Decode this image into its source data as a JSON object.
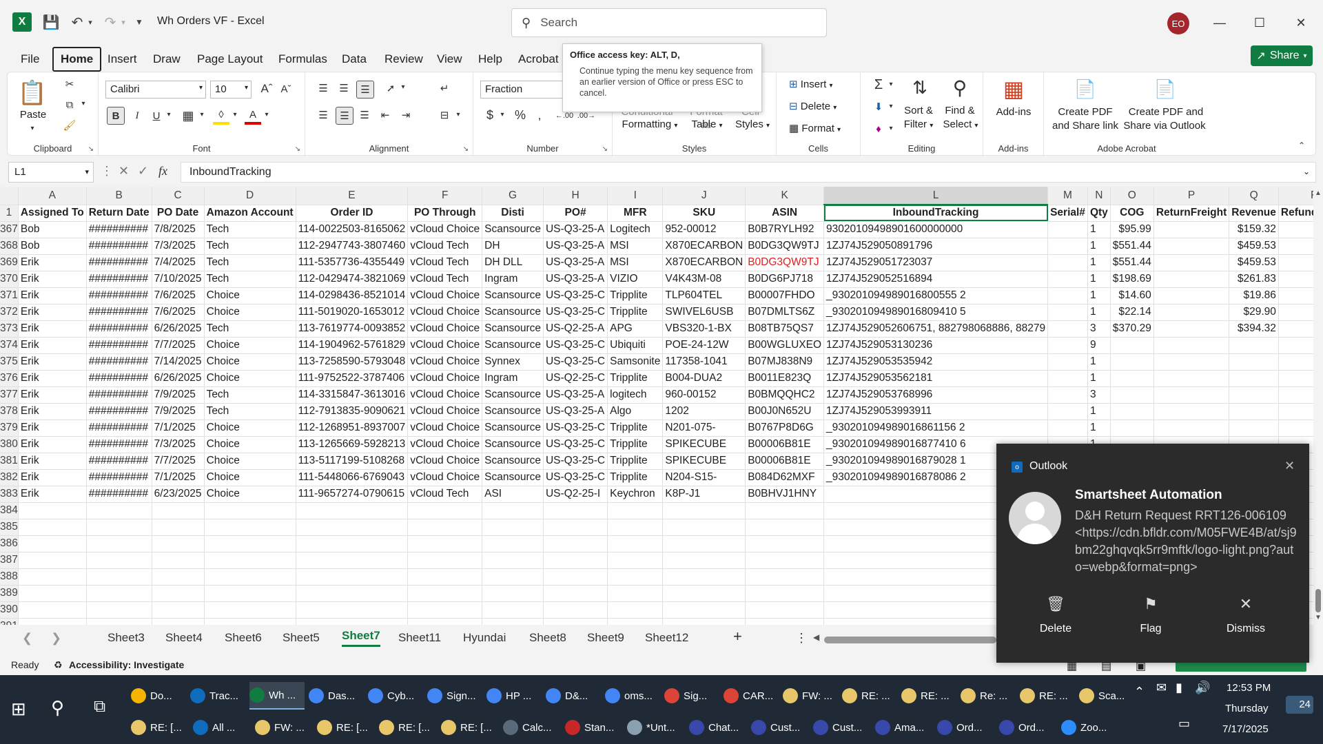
{
  "window": {
    "title": "Wh Orders VF  -  Excel",
    "search_placeholder": "Search",
    "user_initials": "EO",
    "share_label": "Share"
  },
  "menu_tabs": [
    "File",
    "Home",
    "Insert",
    "Draw",
    "Page Layout",
    "Formulas",
    "Data",
    "Review",
    "View",
    "Help",
    "Acrobat"
  ],
  "ribbon": {
    "clipboard": {
      "label": "Clipboard",
      "paste": "Paste"
    },
    "font": {
      "label": "Font",
      "name": "Calibri",
      "size": "10"
    },
    "alignment": {
      "label": "Alignment"
    },
    "number": {
      "label": "Number",
      "format": "Fraction"
    },
    "styles": {
      "label": "Styles",
      "conditional": "Conditional",
      "formatting": "Formatting",
      "format_as": "Format as",
      "table": "Table",
      "cell": "Cell",
      "cell_styles": "Styles"
    },
    "cells": {
      "label": "Cells",
      "insert": "Insert",
      "delete": "Delete",
      "format": "Format"
    },
    "editing": {
      "label": "Editing",
      "sort": "Sort &",
      "filter": "Filter",
      "find": "Find &",
      "select": "Select"
    },
    "addins": {
      "label": "Add-ins",
      "addins": "Add-ins"
    },
    "acrobat": {
      "label": "Adobe Acrobat",
      "pdf1a": "Create PDF",
      "pdf1b": "and Share link",
      "pdf2a": "Create PDF and",
      "pdf2b": "Share via Outlook"
    }
  },
  "tooltip": {
    "title": "Office access key: ALT, D,",
    "body": "Continue typing the menu key sequence from an earlier version of Office or press ESC to cancel."
  },
  "formula_bar": {
    "name_box": "L1",
    "fx": "fx",
    "content": "InboundTracking"
  },
  "grid": {
    "columns": [
      "A",
      "B",
      "C",
      "D",
      "E",
      "F",
      "G",
      "H",
      "I",
      "J",
      "K",
      "L",
      "M",
      "N",
      "O",
      "P",
      "Q",
      "R"
    ],
    "header_row": {
      "row_num": "1",
      "cells": [
        "Assigned To",
        "Return Date",
        "PO Date",
        "Amazon Account",
        "Order ID",
        "PO Through",
        "Disti",
        "PO#",
        "MFR",
        "SKU",
        "ASIN",
        "InboundTracking",
        "Serial#",
        "Qty",
        "COG",
        "ReturnFreight",
        "Revenue",
        "Refund Issue"
      ]
    },
    "rows": [
      {
        "n": "367",
        "c": [
          "Bob",
          "##########",
          "7/8/2025",
          "Tech",
          "114-0022503-8165062",
          "vCloud Choice",
          "Scansource",
          "US-Q3-25-A",
          "Logitech",
          "952-00012",
          "B0B7RYLH92",
          "93020109498901600000000",
          "",
          "1",
          "$95.99",
          "",
          "$159.32",
          ""
        ]
      },
      {
        "n": "368",
        "c": [
          "Bob",
          "##########",
          "7/3/2025",
          "Tech",
          "112-2947743-3807460",
          "vCloud Tech",
          "DH",
          "US-Q3-25-A",
          "MSI",
          "X870ECARBON",
          "B0DG3QW9TJ",
          "1ZJ74J529050891796",
          "",
          "1",
          "$551.44",
          "",
          "$459.53",
          ""
        ]
      },
      {
        "n": "369",
        "c": [
          "Erik",
          "##########",
          "7/4/2025",
          "Tech",
          "111-5357736-4355449",
          "vCloud Tech",
          "DH DLL",
          "US-Q3-25-A",
          "MSI",
          "X870ECARBON",
          "B0DG3QW9TJ",
          "1ZJ74J529051723037",
          "",
          "1",
          "$551.44",
          "",
          "$459.53",
          ""
        ]
      },
      {
        "n": "370",
        "c": [
          "Erik",
          "##########",
          "7/10/2025",
          "Tech",
          "112-0429474-3821069",
          "vCloud Tech",
          "Ingram",
          "US-Q3-25-A",
          "VIZIO",
          "V4K43M-08",
          "B0DG6PJ718",
          "1ZJ74J529052516894",
          "",
          "1",
          "$198.69",
          "",
          "$261.83",
          ""
        ]
      },
      {
        "n": "371",
        "c": [
          "Erik",
          "##########",
          "7/6/2025",
          "Choice",
          "114-0298436-8521014",
          "vCloud Choice",
          "Scansource",
          "US-Q3-25-C",
          "Tripplite",
          "TLP604TEL",
          "B00007FHDO",
          "_930201094989016800555 2",
          "",
          "1",
          "$14.60",
          "",
          "$19.86",
          ""
        ]
      },
      {
        "n": "372",
        "c": [
          "Erik",
          "##########",
          "7/6/2025",
          "Choice",
          "111-5019020-1653012",
          "vCloud Choice",
          "Scansource",
          "US-Q3-25-C",
          "Tripplite",
          "SWIVEL6USB",
          "B07DMLTS6Z",
          "_930201094989016809410 5",
          "",
          "1",
          "$22.14",
          "",
          "$29.90",
          ""
        ]
      },
      {
        "n": "373",
        "c": [
          "Erik",
          "##########",
          "6/26/2025",
          "Tech",
          "113-7619774-0093852",
          "vCloud Choice",
          "Scansource",
          "US-Q2-25-A",
          "APG",
          "VBS320-1-BX",
          "B08TB75QS7",
          "1ZJ74J529052606751, 882798068886, 88279",
          "",
          "3",
          "$370.29",
          "",
          "$394.32",
          ""
        ]
      },
      {
        "n": "374",
        "c": [
          "Erik",
          "##########",
          "7/7/2025",
          "Choice",
          "114-1904962-5761829",
          "vCloud Choice",
          "Scansource",
          "US-Q3-25-C",
          "Ubiquiti",
          "POE-24-12W",
          "B00WGLUXEO",
          "1ZJ74J529053130236",
          "",
          "9",
          "",
          "",
          "",
          ""
        ]
      },
      {
        "n": "375",
        "c": [
          "Erik",
          "##########",
          "7/14/2025",
          "Choice",
          "113-7258590-5793048",
          "vCloud Choice",
          "Synnex",
          "US-Q3-25-C",
          "Samsonite",
          "117358-1041",
          "B07MJ838N9",
          "1ZJ74J529053535942",
          "",
          "1",
          "",
          "",
          "",
          ""
        ]
      },
      {
        "n": "376",
        "c": [
          "Erik",
          "##########",
          "6/26/2025",
          "Choice",
          "111-9752522-3787406",
          "vCloud Choice",
          "Ingram",
          "US-Q2-25-C",
          "Tripplite",
          "B004-DUA2",
          "B0011E823Q",
          "1ZJ74J529053562181",
          "",
          "1",
          "",
          "",
          "",
          ""
        ]
      },
      {
        "n": "377",
        "c": [
          "Erik",
          "##########",
          "7/9/2025",
          "Tech",
          "114-3315847-3613016",
          "vCloud Choice",
          "Scansource",
          "US-Q3-25-A",
          "logitech",
          "960-00152",
          "B0BMQQHC2",
          "1ZJ74J529053768996",
          "",
          "3",
          "",
          "",
          "",
          ""
        ]
      },
      {
        "n": "378",
        "c": [
          "Erik",
          "##########",
          "7/9/2025",
          "Tech",
          "112-7913835-9090621",
          "vCloud Choice",
          "Scansource",
          "US-Q3-25-A",
          "Algo",
          "1202",
          "B00J0N652U",
          "1ZJ74J529053993911",
          "",
          "1",
          "",
          "",
          "",
          ""
        ]
      },
      {
        "n": "379",
        "c": [
          "Erik",
          "##########",
          "7/1/2025",
          "Choice",
          "112-1268951-8937007",
          "vCloud Choice",
          "Scansource",
          "US-Q3-25-C",
          "Tripplite",
          "N201-075-",
          "B0767P8D6G",
          "_930201094989016861156 2",
          "",
          "1",
          "",
          "",
          "",
          ""
        ]
      },
      {
        "n": "380",
        "c": [
          "Erik",
          "##########",
          "7/3/2025",
          "Choice",
          "113-1265669-5928213",
          "vCloud Choice",
          "Scansource",
          "US-Q3-25-C",
          "Tripplite",
          "SPIKECUBE",
          "B00006B81E",
          "_930201094989016877410 6",
          "",
          "1",
          "",
          "",
          "",
          ""
        ]
      },
      {
        "n": "381",
        "c": [
          "Erik",
          "##########",
          "7/7/2025",
          "Choice",
          "113-5117199-5108268",
          "vCloud Choice",
          "Scansource",
          "US-Q3-25-C",
          "Tripplite",
          "SPIKECUBE",
          "B00006B81E",
          "_930201094989016879028 1",
          "",
          "1",
          "",
          "",
          "",
          ""
        ]
      },
      {
        "n": "382",
        "c": [
          "Erik",
          "##########",
          "7/1/2025",
          "Choice",
          "111-5448066-6769043",
          "vCloud Choice",
          "Scansource",
          "US-Q3-25-C",
          "Tripplite",
          "N204-S15-",
          "B084D62MXF",
          "_930201094989016878086 2",
          "",
          "1",
          "",
          "",
          "",
          ""
        ]
      },
      {
        "n": "383",
        "c": [
          "Erik",
          "##########",
          "6/23/2025",
          "Choice",
          "111-9657274-0790615",
          "vCloud Tech",
          "ASI",
          "US-Q2-25-I",
          "Keychron",
          "K8P-J1",
          "B0BHVJ1HNY",
          "",
          "",
          "1",
          "",
          "",
          "",
          ""
        ]
      },
      {
        "n": "384",
        "c": [
          "",
          "",
          "",
          "",
          "",
          "",
          "",
          "",
          "",
          "",
          "",
          "",
          "",
          "",
          "",
          "",
          "",
          ""
        ]
      },
      {
        "n": "385",
        "c": [
          "",
          "",
          "",
          "",
          "",
          "",
          "",
          "",
          "",
          "",
          "",
          "",
          "",
          "",
          "",
          "",
          "",
          ""
        ]
      },
      {
        "n": "386",
        "c": [
          "",
          "",
          "",
          "",
          "",
          "",
          "",
          "",
          "",
          "",
          "",
          "",
          "",
          "",
          "",
          "",
          "",
          ""
        ]
      },
      {
        "n": "387",
        "c": [
          "",
          "",
          "",
          "",
          "",
          "",
          "",
          "",
          "",
          "",
          "",
          "",
          "",
          "",
          "",
          "",
          "",
          ""
        ]
      },
      {
        "n": "388",
        "c": [
          "",
          "",
          "",
          "",
          "",
          "",
          "",
          "",
          "",
          "",
          "",
          "",
          "",
          "",
          "",
          "",
          "",
          ""
        ]
      },
      {
        "n": "389",
        "c": [
          "",
          "",
          "",
          "",
          "",
          "",
          "",
          "",
          "",
          "",
          "",
          "",
          "",
          "",
          "",
          "",
          "",
          ""
        ]
      },
      {
        "n": "390",
        "c": [
          "",
          "",
          "",
          "",
          "",
          "",
          "",
          "",
          "",
          "",
          "",
          "",
          "",
          "",
          "",
          "",
          "",
          ""
        ]
      },
      {
        "n": "391",
        "c": [
          "",
          "",
          "",
          "",
          "",
          "",
          "",
          "",
          "",
          "",
          "",
          "",
          "",
          "",
          "",
          "",
          "",
          ""
        ]
      }
    ]
  },
  "sheets": [
    "Sheet3",
    "Sheet4",
    "Sheet6",
    "Sheet5",
    "Sheet7",
    "Sheet11",
    "Hyundai",
    "Sheet8",
    "Sheet9",
    "Sheet12"
  ],
  "active_sheet": "Sheet7",
  "status": {
    "ready": "Ready",
    "accessibility": "Accessibility: Investigate"
  },
  "notification": {
    "app": "Outlook",
    "sender": "Smartsheet Automation",
    "message": "D&H Return Request RRT126-006109 <https://cdn.bfldr.com/M05FWE4B/at/sj9bm22ghqvqk5rr9mftk/logo-light.png?auto=webp&format=png>",
    "actions": [
      "Delete",
      "Flag",
      "Dismiss"
    ]
  },
  "taskbar": {
    "row1": [
      "Do...",
      "Trac...",
      "Wh ...",
      "Das...",
      "Cyb...",
      "Sign...",
      "HP ...",
      "D&...",
      "oms...",
      "Sig...",
      "CAR...",
      "FW: ...",
      "RE: ...",
      "RE: ...",
      "Re: ...",
      "RE: ...",
      "Sca..."
    ],
    "row2": [
      "RE: [...",
      "All ...",
      "FW: ...",
      "RE: [...",
      "RE: [...",
      "RE: [...",
      "Calc...",
      "Stan...",
      "*Unt...",
      "Chat...",
      "Cust...",
      "Cust...",
      "Ama...",
      "Ord...",
      "Ord...",
      "Zoo..."
    ],
    "time": "12:53 PM",
    "day": "Thursday",
    "date": "7/17/2025",
    "badge": "24"
  },
  "colors": {
    "excel_green": "#107c41",
    "title_bg": "#f3f3f3",
    "taskbar_bg": "#1f2a36",
    "notif_bg": "#2b2b2b"
  }
}
